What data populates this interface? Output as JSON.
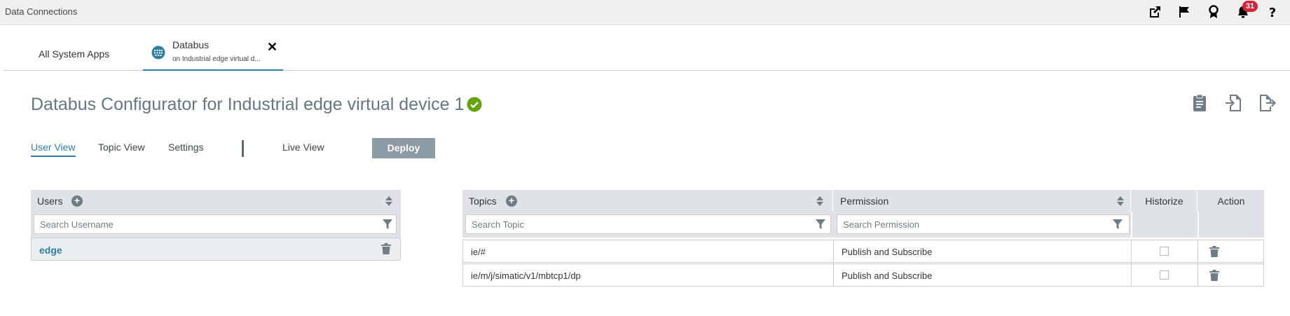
{
  "topbar": {
    "title": "Data Connections",
    "notification_count": "31",
    "icons": [
      "external-link-icon",
      "flag-icon",
      "award-icon",
      "bell-icon",
      "help-icon"
    ]
  },
  "app_tabs": {
    "all_apps_label": "All System Apps",
    "active_tab_name": "Databus",
    "active_tab_subtitle": "on Industrial edge virtual d...",
    "close_label": "✕"
  },
  "page": {
    "title": "Databus Configurator for Industrial edge virtual device 1",
    "status": "ok"
  },
  "subtabs": {
    "user_view": "User View",
    "topic_view": "Topic View",
    "settings": "Settings",
    "live_view": "Live View",
    "deploy": "Deploy"
  },
  "users_table": {
    "header": "Users",
    "search_placeholder": "Search Username",
    "rows": [
      {
        "name": "edge"
      }
    ]
  },
  "topics_table": {
    "headers": {
      "topics": "Topics",
      "permission": "Permission",
      "historize": "Historize",
      "action": "Action"
    },
    "search_topic_placeholder": "Search Topic",
    "search_permission_placeholder": "Search Permission",
    "rows": [
      {
        "topic": "ie/#",
        "permission": "Publish and Subscribe",
        "historize": false
      },
      {
        "topic": "ie/m/j/simatic/v1/mbtcp1/dp",
        "permission": "Publish and Subscribe",
        "historize": false
      }
    ]
  },
  "colors": {
    "accent": "#2f7fa3",
    "title_gray": "#647882",
    "status_green": "#65a30d",
    "badge_red": "#d72339",
    "header_bg": "#dfe3e8",
    "deploy_bg": "#8c9aa3"
  }
}
